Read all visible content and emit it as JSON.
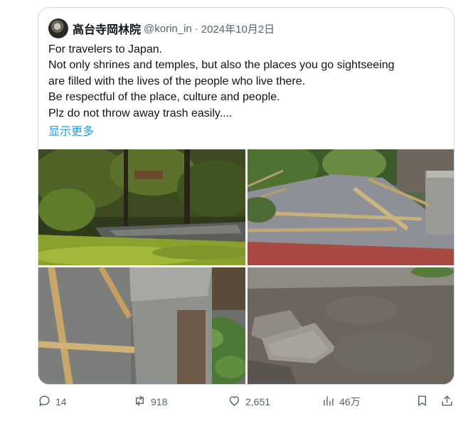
{
  "tweet": {
    "author": {
      "display_name": "高台寺岡林院",
      "handle": "@korin_in",
      "separator": "·",
      "date": "2024年10月2日",
      "avatar_icon": "avatar"
    },
    "text_lines": [
      "For travelers to Japan.",
      "Not only shrines and temples, but also the places you go sightseeing",
      "are filled with the lives of the people who live there.",
      "Be respectful of the place, culture and people.",
      "Plz do not throw away trash easily...."
    ],
    "show_more": "显示更多",
    "link_color": "#1d9bf0"
  },
  "media": {
    "photos": [
      {
        "name": "photo-moss-garden"
      },
      {
        "name": "photo-bamboo-poles-path"
      },
      {
        "name": "photo-stone-post-bamboo"
      },
      {
        "name": "photo-broken-stone-ground"
      }
    ]
  },
  "actions": {
    "reply": {
      "count": "14",
      "icon": "reply-icon"
    },
    "retweet": {
      "count": "918",
      "icon": "retweet-icon"
    },
    "like": {
      "count": "2,651",
      "icon": "heart-icon"
    },
    "views": {
      "count": "46万",
      "icon": "views-icon"
    },
    "bookmark": {
      "icon": "bookmark-icon"
    },
    "share": {
      "icon": "share-icon"
    }
  }
}
